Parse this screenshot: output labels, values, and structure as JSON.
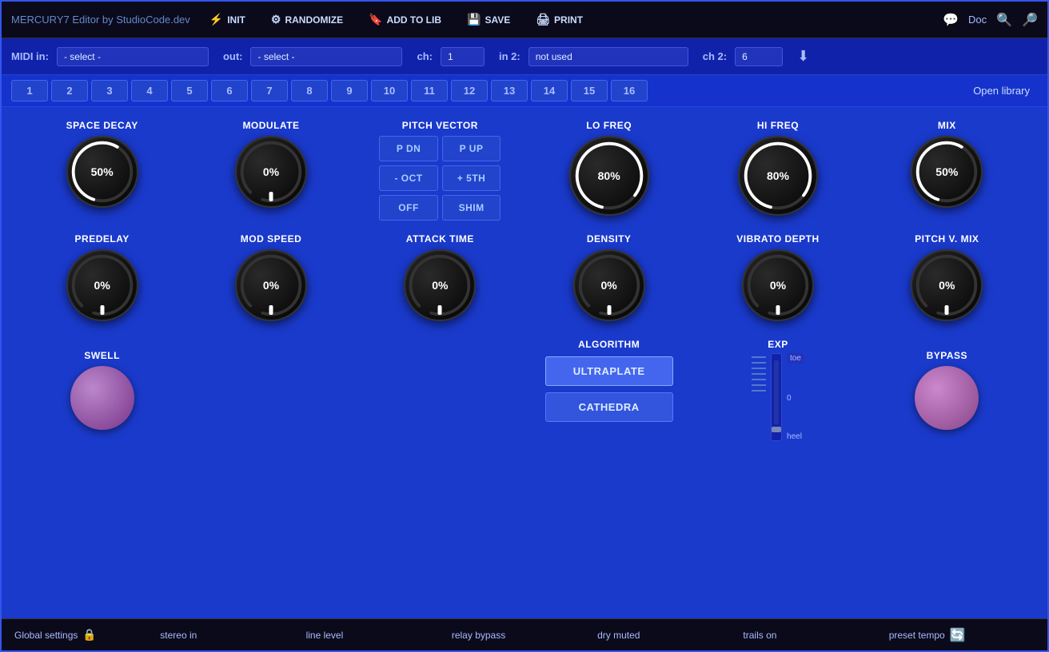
{
  "app": {
    "title": "MERCURY7 Editor",
    "subtitle": "by StudioCode.dev"
  },
  "toolbar": {
    "init_label": "INIT",
    "randomize_label": "RANDOMIZE",
    "add_to_lib_label": "ADD TO LIB",
    "save_label": "SAVE",
    "print_label": "PRINT",
    "doc_label": "Doc"
  },
  "midi": {
    "in_label": "MIDI  in:",
    "in_placeholder": "- select -",
    "out_label": "out:",
    "out_placeholder": "- select -",
    "ch_label": "ch:",
    "ch_value": "1",
    "in2_label": "in 2:",
    "in2_value": "not used",
    "ch2_label": "ch 2:",
    "ch2_value": "6"
  },
  "presets": {
    "buttons": [
      "1",
      "2",
      "3",
      "4",
      "5",
      "6",
      "7",
      "8",
      "9",
      "10",
      "11",
      "12",
      "13",
      "14",
      "15",
      "16"
    ],
    "open_library": "Open library"
  },
  "knobs": {
    "row1": [
      {
        "label": "SPACE DECAY",
        "value": "50%",
        "percent": 50
      },
      {
        "label": "MODULATE",
        "value": "0%",
        "percent": 0
      },
      {
        "label": "PITCH VECTOR",
        "value": null,
        "percent": null
      },
      {
        "label": "LO FREQ",
        "value": "80%",
        "percent": 80
      },
      {
        "label": "HI FREQ",
        "value": "80%",
        "percent": 80
      },
      {
        "label": "MIX",
        "value": "50%",
        "percent": 50
      }
    ],
    "row2": [
      {
        "label": "PREDELAY",
        "value": "0%",
        "percent": 0
      },
      {
        "label": "MOD SPEED",
        "value": "0%",
        "percent": 0
      },
      {
        "label": "ATTACK TIME",
        "value": "0%",
        "percent": 0
      },
      {
        "label": "DENSITY",
        "value": "0%",
        "percent": 0
      },
      {
        "label": "VIBRATO DEPTH",
        "value": "0%",
        "percent": 0
      },
      {
        "label": "PITCH V. MIX",
        "value": "0%",
        "percent": 0
      }
    ]
  },
  "pitch_vector": {
    "buttons": [
      "P DN",
      "P UP",
      "- OCT",
      "+ 5TH",
      "OFF",
      "SHIM"
    ]
  },
  "algorithm": {
    "label": "ALGORITHM",
    "buttons": [
      "ULTRAPLATE",
      "CATHEDRA"
    ]
  },
  "exp": {
    "label": "EXP",
    "toe_label": "toe",
    "value_label": "0",
    "heel_label": "heel"
  },
  "bypass": {
    "label": "BYPASS"
  },
  "swell": {
    "label": "SWELL"
  },
  "status_bar": {
    "global_settings": "Global settings",
    "stereo_in": "stereo in",
    "line_level": "line level",
    "relay_bypass": "relay bypass",
    "dry_muted": "dry muted",
    "trails_on": "trails on",
    "preset_tempo": "preset tempo"
  },
  "colors": {
    "bg_blue": "#1a3acc",
    "dark_blue": "#0a0a1a",
    "accent_blue": "#2244cc",
    "knob_black": "#000000",
    "arc_white": "#ffffff",
    "text_light": "#aabbff",
    "bypass_purple": "#cc88cc",
    "swell_purple": "#bb88cc"
  }
}
